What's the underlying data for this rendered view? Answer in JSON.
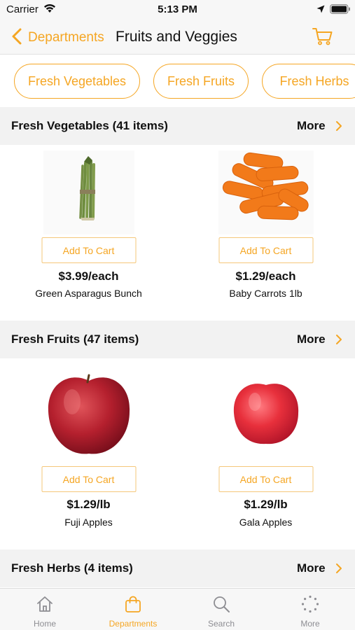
{
  "status": {
    "carrier": "Carrier",
    "time": "5:13 PM"
  },
  "nav": {
    "back_label": "Departments",
    "title": "Fruits and Veggies"
  },
  "chips": [
    "Fresh Vegetables",
    "Fresh Fruits",
    "Fresh Herbs"
  ],
  "sections": [
    {
      "title": "Fresh Vegetables (41 items)",
      "more": "More",
      "products": [
        {
          "add_label": "Add To Cart",
          "price": "$3.99/each",
          "name": "Green Asparagus Bunch",
          "image": "asparagus"
        },
        {
          "add_label": "Add To Cart",
          "price": "$1.29/each",
          "name": "Baby Carrots 1lb",
          "image": "carrots"
        }
      ]
    },
    {
      "title": "Fresh Fruits (47 items)",
      "more": "More",
      "products": [
        {
          "add_label": "Add To Cart",
          "price": "$1.29/lb",
          "name": "Fuji Apples",
          "image": "fuji-apple"
        },
        {
          "add_label": "Add To Cart",
          "price": "$1.29/lb",
          "name": "Gala Apples",
          "image": "gala-apple"
        }
      ]
    },
    {
      "title": "Fresh Herbs (4 items)",
      "more": "More",
      "products": []
    }
  ],
  "tabs": [
    {
      "label": "Home",
      "icon": "home-icon",
      "active": false
    },
    {
      "label": "Departments",
      "icon": "shopping-bag-icon",
      "active": true
    },
    {
      "label": "Search",
      "icon": "search-icon",
      "active": false
    },
    {
      "label": "More",
      "icon": "more-dots-icon",
      "active": false
    }
  ],
  "colors": {
    "accent": "#f5a623",
    "section_bg": "#f2f2f2",
    "bar_bg": "#f7f7f7",
    "inactive_tab": "#8e8e93"
  }
}
